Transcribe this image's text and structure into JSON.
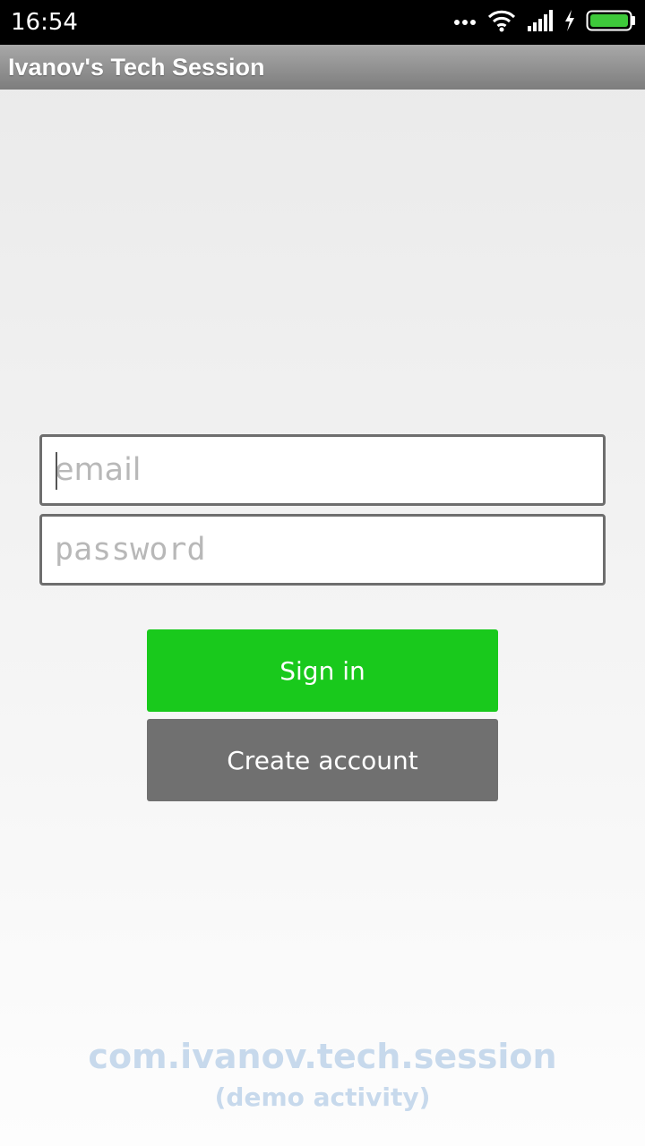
{
  "status_bar": {
    "time": "16:54",
    "icons": [
      "more-dots-icon",
      "wifi-icon",
      "signal-icon",
      "charging-bolt-icon",
      "battery-icon"
    ]
  },
  "app_bar": {
    "title": "Ivanov's Tech Session"
  },
  "form": {
    "email": {
      "placeholder": "email",
      "value": ""
    },
    "password": {
      "placeholder": "password",
      "value": ""
    }
  },
  "buttons": {
    "sign_in": "Sign in",
    "create_account": "Create account"
  },
  "footer": {
    "package": "com.ivanov.tech.session",
    "subtitle": "(demo activity)"
  },
  "colors": {
    "sign_in": "#19c91c",
    "create_account": "#707070",
    "battery": "#3ec93a",
    "footer_text": "#c7d9ec"
  }
}
